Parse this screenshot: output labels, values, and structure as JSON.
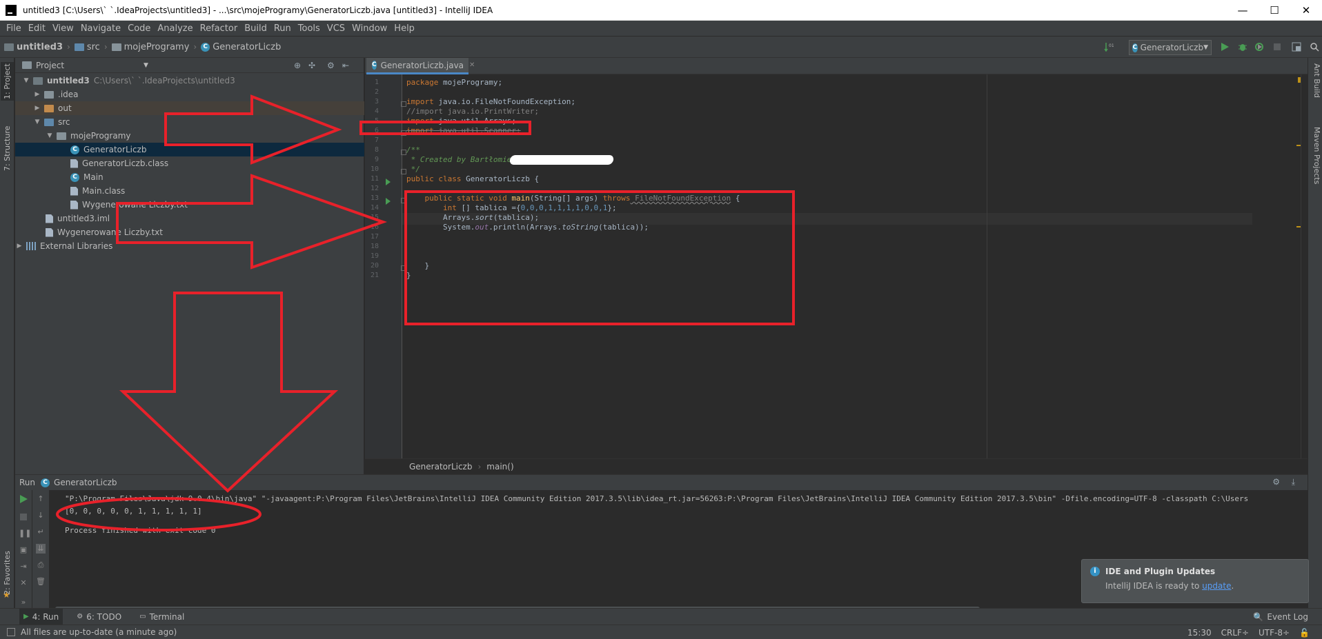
{
  "window": {
    "title": "untitled3 [C:\\Users\\`    `.IdeaProjects\\untitled3] - ...\\src\\mojeProgramy\\GeneratorLiczb.java [untitled3] - IntelliJ IDEA",
    "minimize_glyph": "—",
    "maximize_glyph": "☐",
    "close_glyph": "✕"
  },
  "menu": [
    "File",
    "Edit",
    "View",
    "Navigate",
    "Code",
    "Analyze",
    "Refactor",
    "Build",
    "Run",
    "Tools",
    "VCS",
    "Window",
    "Help"
  ],
  "navbar": {
    "crumbs": [
      "untitled3",
      "src",
      "mojeProgramy",
      "GeneratorLiczb"
    ],
    "run_config": "GeneratorLiczb"
  },
  "left_stripe": {
    "project": "1: Project",
    "structure": "7: Structure",
    "favorites": "2: Favorites"
  },
  "right_stripe": {
    "ant": "Ant Build",
    "maven": "Maven Projects"
  },
  "project_panel": {
    "title": "Project",
    "tree": [
      {
        "label": "untitled3",
        "sub": "C:\\Users\\`     `.IdeaProjects\\untitled3"
      },
      {
        "label": ".idea"
      },
      {
        "label": "out"
      },
      {
        "label": "src"
      },
      {
        "label": "mojeProgramy"
      },
      {
        "label": "GeneratorLiczb"
      },
      {
        "label": "GeneratorLiczb.class"
      },
      {
        "label": "Main"
      },
      {
        "label": "Main.class"
      },
      {
        "label": "Wygenerowane Liczby.txt"
      },
      {
        "label": "untitled3.iml"
      },
      {
        "label": "Wygenerowane Liczby.txt"
      },
      {
        "label": "External Libraries"
      }
    ]
  },
  "editor": {
    "tab": "GeneratorLiczb.java",
    "line_numbers": [
      "1",
      "2",
      "3",
      "4",
      "5",
      "6",
      "7",
      "8",
      "9",
      "10",
      "11",
      "12",
      "13",
      "14",
      "15",
      "16",
      "17",
      "18",
      "19",
      "20",
      "21"
    ],
    "code": {
      "l1_kw": "package",
      "l1_rest": " mojeProgramy;",
      "l3_kw": "import",
      "l3_rest": " java.io.FileNotFoundException;",
      "l4": "//import java.io.PrintWriter;",
      "l5_kw": "import",
      "l5_rest": " java.util.Arrays;",
      "l6_kw": "import",
      "l6_rest": " java.util.Scanner;",
      "l8": "/**",
      "l9": " * Created by Bartłomiej",
      "l10": " */",
      "l11_kw": "public class",
      "l11_rest": " GeneratorLiczb {",
      "l13_kw": "    public static void",
      "l13_fn": " main",
      "l13_rest": "(String[] args) ",
      "l13_kw2": "throws",
      "l13_ex": " FileNotFoundException",
      "l13_end": " {",
      "l14_kw": "        int",
      "l14_rest": " [] tablica ={",
      "l14_nums": "0,0,0,1,1,1,1,0,0,1",
      "l14_end": "};",
      "l15_a": "        Arrays.",
      "l15_it": "sort",
      "l15_end": "(tablica);",
      "l16_a": "        System.",
      "l16_st": "out",
      "l16_b": ".println(Arrays.",
      "l16_it": "toString",
      "l16_end": "(tablica));",
      "l20": "    }",
      "l21": "}"
    },
    "breadcrumbs": [
      "GeneratorLiczb",
      "main()"
    ]
  },
  "run_panel": {
    "title": "Run",
    "config": "GeneratorLiczb",
    "command": "\"P:\\Program Files\\Java\\jdk-9.0.4\\bin\\java\" \"-javaagent:P:\\Program Files\\JetBrains\\IntelliJ IDEA Community Edition 2017.3.5\\lib\\idea_rt.jar=56263:P:\\Program Files\\JetBrains\\IntelliJ IDEA Community Edition 2017.3.5\\bin\" -Dfile.encoding=UTF-8 -classpath C:\\Users",
    "output": "[0, 0, 0, 0, 0, 1, 1, 1, 1, 1]",
    "exit": "Process finished with exit code 0"
  },
  "notification": {
    "title": "IDE and Plugin Updates",
    "body": "IntelliJ IDEA is ready to ",
    "link": "update",
    "end": "."
  },
  "tool_tabs": {
    "run": "4: Run",
    "todo": "6: TODO",
    "terminal": "Terminal",
    "event_log": "Event Log"
  },
  "status": {
    "message": "All files are up-to-date (a minute ago)",
    "position": "15:30",
    "line_sep": "CRLF÷",
    "encoding": "UTF-8÷"
  },
  "colors": {
    "accent": "#4a88c7",
    "annotation": "#e8212a",
    "run_green": "#499c54"
  }
}
